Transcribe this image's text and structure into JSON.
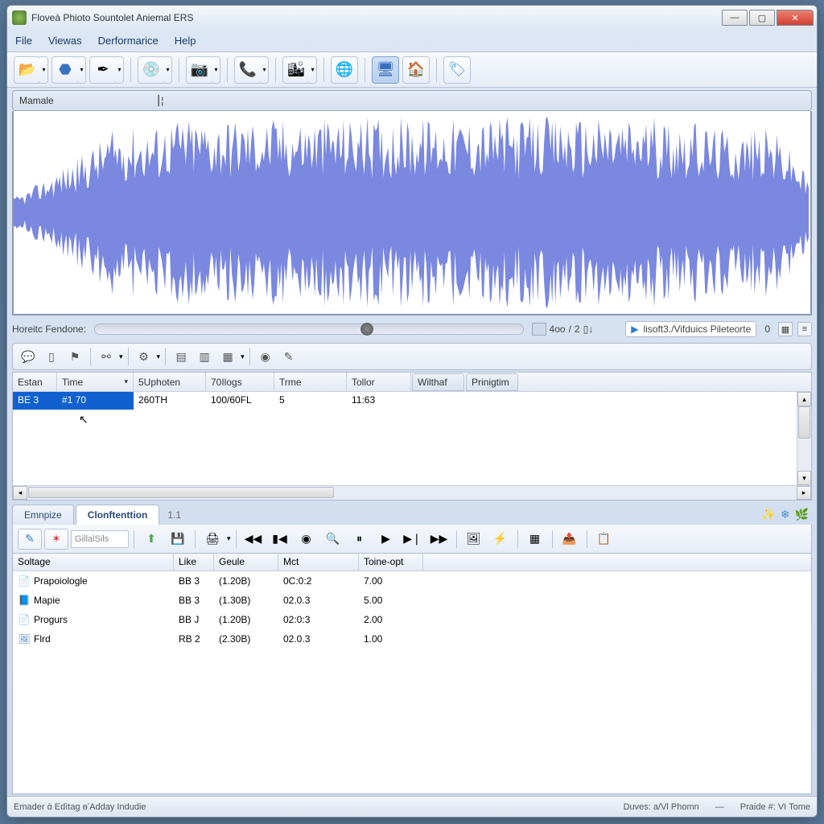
{
  "window": {
    "title": "Floveà Phioto Sountolet Aniemal ERS"
  },
  "menubar": [
    "File",
    "Viewas",
    "Derformarice",
    "Help"
  ],
  "track": {
    "label": "Mamale",
    "playhead": "⎮¦"
  },
  "slider": {
    "label": "Horeitc Fendone:",
    "page_cur": "4oo",
    "page_tot": "2",
    "path_icon": "▶",
    "path": "lisoft3./Vifduics Pileteorte",
    "path_zero": "0"
  },
  "grid1": {
    "cols": [
      "Estan",
      "Time",
      "5Uphoten",
      "70Ilogs",
      "Trme",
      "Tollor"
    ],
    "tabs": [
      "Wilthaf",
      "Prinigtim"
    ],
    "rows": [
      {
        "c0": "BE 3",
        "c1": "#1 70",
        "c2": "260TH",
        "c3": "100/60FL",
        "c4": "5",
        "c5": "11:63"
      }
    ]
  },
  "tabs": {
    "items": [
      "Emnpize",
      "Clonftenttion"
    ],
    "active": 1,
    "version": "1.1"
  },
  "toolbar3": {
    "combo": "GillalSils"
  },
  "grid2": {
    "cols": [
      "Soltage",
      "Like",
      "Geule",
      "Mct",
      "Toine-opt"
    ],
    "rows": [
      {
        "icon": "📄",
        "icon_color": "#3aa050",
        "name": "Prapoiologle",
        "like": "BB 3",
        "geule": "(1.20B)",
        "mct": "0C:0:2",
        "toine": "7.00"
      },
      {
        "icon": "📘",
        "icon_color": "#3a70c0",
        "name": "Mapie",
        "like": "BB 3",
        "geule": "(1.30B)",
        "mct": "02.0.3",
        "toine": "5.00"
      },
      {
        "icon": "📄",
        "icon_color": "#4a80c8",
        "name": "Progurs",
        "like": "BB J",
        "geule": "(1.20B)",
        "mct": "02:0:3",
        "toine": "2.00"
      },
      {
        "icon": "🖼",
        "icon_color": "#4a80c8",
        "name": "Flrd",
        "like": "RB 2",
        "geule": "(2.30B)",
        "mct": "02.0.3",
        "toine": "1.00"
      }
    ]
  },
  "status": {
    "left": "Emader ɑ̀ Edìtag ɵ̛ Adday Indudie",
    "mid": "Duves:  a/Vl Phomn",
    "right": "Praide #: VI Tome"
  }
}
